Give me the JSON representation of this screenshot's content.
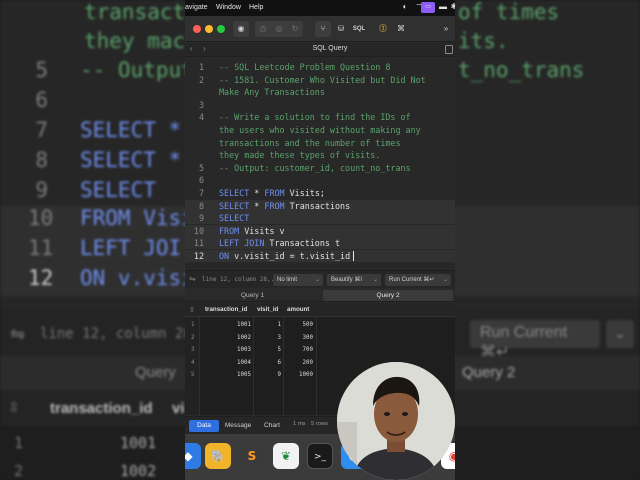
{
  "background": {
    "top_line_1": "transact",
    "top_line_1_right": "of times",
    "top_line_2": "they mac",
    "top_line_2_right": "its.",
    "top_line_3": "-- Output",
    "top_line_3_right": "t_no_trans",
    "code_lines": [
      {
        "num": "5",
        "text": ""
      },
      {
        "num": "6",
        "text": ""
      },
      {
        "num": "7",
        "text": "SELECT *"
      },
      {
        "num": "8",
        "text": "SELECT *"
      },
      {
        "num": "9",
        "text": "SELECT"
      },
      {
        "num": "10",
        "text": "FROM Visi"
      },
      {
        "num": "11",
        "text": "LEFT JOI"
      },
      {
        "num": "12",
        "text": "ON v.visi"
      }
    ],
    "status_text": "line 12, column 28,...",
    "run_label": "Run Current ⌘↵",
    "tab_query_1": "Query",
    "tab_query_2": "Query 2",
    "col_1": "transaction_id",
    "col_2": "vi",
    "rows": [
      {
        "num": "1",
        "val": "1001"
      },
      {
        "num": "2",
        "val": "1002"
      }
    ]
  },
  "menubar": {
    "navigate": "avigate",
    "window": "Window",
    "help": "Help"
  },
  "toolbar": {
    "sql_label": "SQL",
    "tab_title": "SQL Query"
  },
  "editor": {
    "lines": [
      {
        "num": "1",
        "segments": [
          {
            "t": "-- SQL Leetcode Problem Question 8",
            "c": "com"
          }
        ]
      },
      {
        "num": "2",
        "segments": [
          {
            "t": "-- 1581. Customer Who Visited but Did Not",
            "c": "com"
          }
        ]
      },
      {
        "num": "",
        "segments": [
          {
            "t": "Make Any Transactions",
            "c": "com"
          }
        ]
      },
      {
        "num": "3",
        "segments": []
      },
      {
        "num": "4",
        "segments": [
          {
            "t": "-- Write a solution to find the IDs of",
            "c": "com"
          }
        ]
      },
      {
        "num": "",
        "segments": [
          {
            "t": "the users who visited without making any",
            "c": "com"
          }
        ]
      },
      {
        "num": "",
        "segments": [
          {
            "t": "transactions and the number of times",
            "c": "com"
          }
        ]
      },
      {
        "num": "",
        "segments": [
          {
            "t": "they made these types of visits.",
            "c": "com"
          }
        ]
      },
      {
        "num": "5",
        "segments": [
          {
            "t": "-- Output: customer_id, count_no_trans",
            "c": "com"
          }
        ]
      },
      {
        "num": "6",
        "segments": []
      },
      {
        "num": "7",
        "segments": [
          {
            "t": "SELECT",
            "c": "kw"
          },
          {
            "t": " * ",
            "c": "pl"
          },
          {
            "t": "FROM",
            "c": "kw"
          },
          {
            "t": " Visits;",
            "c": "pl"
          }
        ]
      },
      {
        "num": "8",
        "segments": [
          {
            "t": "SELECT",
            "c": "kw"
          },
          {
            "t": " * ",
            "c": "pl"
          },
          {
            "t": "FROM",
            "c": "kw"
          },
          {
            "t": " Transactions",
            "c": "pl"
          }
        ]
      },
      {
        "num": "9",
        "segments": [
          {
            "t": "SELECT",
            "c": "kw"
          }
        ]
      },
      {
        "num": "10",
        "segments": [
          {
            "t": "FROM",
            "c": "kw"
          },
          {
            "t": " Visits v",
            "c": "pl"
          }
        ]
      },
      {
        "num": "11",
        "segments": [
          {
            "t": "LEFT JOIN",
            "c": "kw"
          },
          {
            "t": " Transactions t",
            "c": "pl"
          }
        ]
      },
      {
        "num": "12",
        "segments": [
          {
            "t": "ON",
            "c": "kw"
          },
          {
            "t": " v.visit_id = t.visit_id",
            "c": "pl"
          }
        ]
      }
    ]
  },
  "statusbar": {
    "cursor_position": "line 12, column 28,...",
    "limit_label": "No limit",
    "beautify_label": "Beautify ⌘I",
    "run_label": "Run Current ⌘↵"
  },
  "query_tabs": [
    "Query 1",
    "Query 2"
  ],
  "results": {
    "columns": [
      "transaction_id",
      "visit_id",
      "amount"
    ],
    "rows": [
      {
        "n": "1",
        "transaction_id": "1001",
        "visit_id": "1",
        "amount": "500"
      },
      {
        "n": "2",
        "transaction_id": "1002",
        "visit_id": "3",
        "amount": "300"
      },
      {
        "n": "3",
        "transaction_id": "1003",
        "visit_id": "5",
        "amount": "700"
      },
      {
        "n": "4",
        "transaction_id": "1004",
        "visit_id": "6",
        "amount": "200"
      },
      {
        "n": "5",
        "transaction_id": "1005",
        "visit_id": "9",
        "amount": "1000"
      }
    ]
  },
  "bottombar": {
    "tabs": [
      "Data",
      "Message",
      "Chart"
    ],
    "time": "1 ms",
    "row_count": "5 rows"
  },
  "dock_icons": [
    "app-icon",
    "tableplus-icon",
    "sublime-text-icon",
    "mongodb-compass-icon",
    "terminal-icon",
    "finder-icon",
    "chrome-icon"
  ],
  "colors": {
    "comment": "#5aa26a",
    "keyword": "#6f8ff0",
    "plain": "#e0e0e0",
    "active_tab": "#2f6fe0",
    "menubar_badge": "#8b5cf6"
  }
}
